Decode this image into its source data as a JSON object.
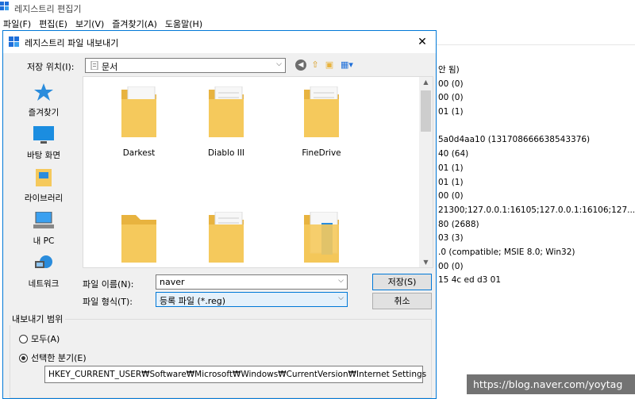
{
  "background_window": {
    "title": "레지스트리 편집기",
    "menu": [
      "파일(F)",
      "편집(E)",
      "보기(V)",
      "즐겨찾기(A)",
      "도움말(H)"
    ],
    "values": [
      "안 됨)",
      "00 (0)",
      "00 (0)",
      "01 (1)",
      "",
      "5a0d4aa10 (131708666638543376)",
      "40 (64)",
      "01 (1)",
      "01 (1)",
      "00 (0)",
      "21300;127.0.0.1:16105;127.0.0.1:16106;127....",
      "80 (2688)",
      "03 (3)",
      ".0 (compatible; MSIE 8.0; Win32)",
      "00 (0)",
      "15 4c ed d3 01"
    ]
  },
  "dialog": {
    "title": "레지스트리 파일 내보내기",
    "close_glyph": "✕",
    "look_in_label": "저장 위치(I):",
    "look_in_value": "문서",
    "places": [
      {
        "label": "즐겨찾기",
        "icon": "star-icon"
      },
      {
        "label": "바탕 화면",
        "icon": "desktop-icon"
      },
      {
        "label": "라이브러리",
        "icon": "library-icon"
      },
      {
        "label": "내 PC",
        "icon": "computer-icon"
      },
      {
        "label": "네트워크",
        "icon": "network-icon"
      }
    ],
    "files": [
      {
        "name": "Darkest"
      },
      {
        "name": "Diablo III"
      },
      {
        "name": "FineDrive"
      },
      {
        "name": ""
      },
      {
        "name": ""
      },
      {
        "name": ""
      }
    ],
    "file_name_label": "파일 이름(N):",
    "file_name_value": "naver",
    "file_type_label": "파일 형식(T):",
    "file_type_value": "등록 파일 (*.reg)",
    "save_button": "저장(S)",
    "cancel_button": "취소",
    "export_range_label": "내보내기 범위",
    "radio_all": "모두(A)",
    "radio_selected": "선택한 분기(E)",
    "selected_branch": "HKEY_CURRENT_USER₩Software₩Microsoft₩Windows₩CurrentVersion₩Internet Settings"
  },
  "watermark": "https://blog.naver.com/yoytag",
  "colors": {
    "accent": "#0078d7",
    "folder": "#f5c95c",
    "folder_dark": "#e8b33f"
  }
}
